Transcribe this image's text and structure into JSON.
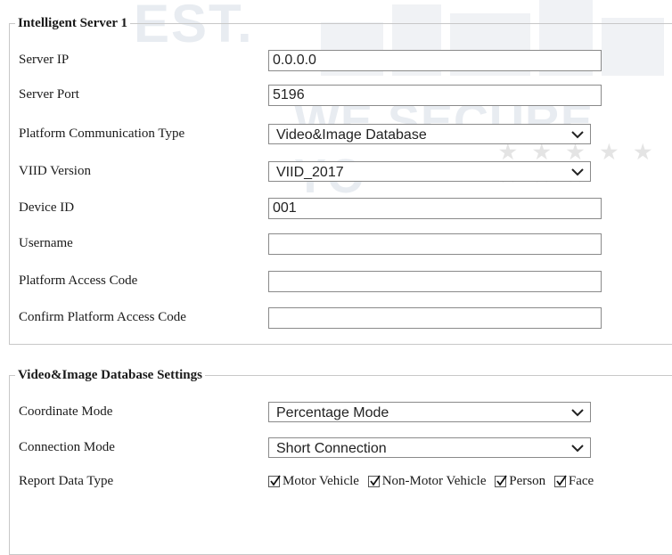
{
  "watermark": {
    "brand": "EST.",
    "slogan": "WE SECURE YO",
    "stars": "★ ★ ★ ★ ★ ★ ★ ★"
  },
  "server_group": {
    "title": "Intelligent Server 1",
    "fields": {
      "server_ip": {
        "label": "Server IP",
        "value": "0.0.0.0"
      },
      "server_port": {
        "label": "Server Port",
        "value": "5196"
      },
      "platform_type": {
        "label": "Platform Communication Type",
        "value": "Video&Image Database"
      },
      "viid_version": {
        "label": "VIID Version",
        "value": "VIID_2017"
      },
      "device_id": {
        "label": "Device ID",
        "value": "001"
      },
      "username": {
        "label": "Username",
        "value": ""
      },
      "access_code": {
        "label": "Platform Access Code",
        "value": ""
      },
      "confirm_access_code": {
        "label": "Confirm Platform Access Code",
        "value": ""
      }
    }
  },
  "database_group": {
    "title": "Video&Image Database Settings",
    "fields": {
      "coordinate_mode": {
        "label": "Coordinate Mode",
        "value": "Percentage Mode"
      },
      "connection_mode": {
        "label": "Connection Mode",
        "value": "Short Connection"
      },
      "report_data_type": {
        "label": "Report Data Type",
        "options": [
          {
            "label": "Motor Vehicle",
            "checked": true
          },
          {
            "label": "Non-Motor Vehicle",
            "checked": true
          },
          {
            "label": "Person",
            "checked": true
          },
          {
            "label": "Face",
            "checked": true
          }
        ]
      }
    }
  },
  "icons": {
    "dropdown": "chevron-down-icon",
    "checked": "checkmark-icon"
  },
  "colors": {
    "border": "#8a8a8a",
    "group_border": "#c8c8c8",
    "watermark": "#e8ecf1"
  }
}
